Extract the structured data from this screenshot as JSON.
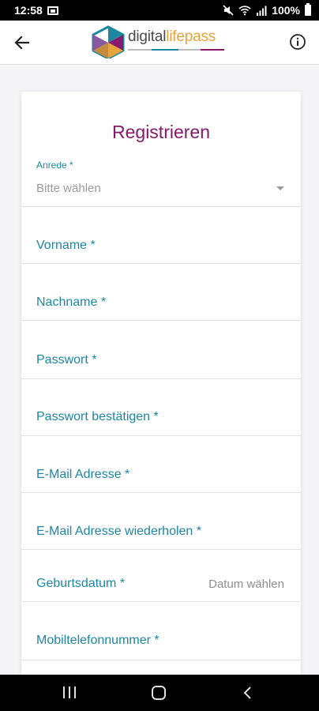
{
  "status_bar": {
    "time": "12:58",
    "battery": "100%"
  },
  "header": {
    "logo_text_a": "digital",
    "logo_text_b": "lifepass",
    "brand_colors": {
      "purple": "#86196b",
      "teal": "#1d86a1",
      "orange": "#e8a33d",
      "grey": "#4a4a4a"
    }
  },
  "form": {
    "title": "Registrieren",
    "salutation": {
      "label": "Anrede *",
      "placeholder": "Bitte wählen"
    },
    "fields": {
      "first_name": "Vorname *",
      "last_name": "Nachname *",
      "password": "Passwort *",
      "password_confirm": "Passwort bestätigen *",
      "email": "E-Mail Adresse *",
      "email_repeat": "E-Mail Adresse wiederholen *",
      "birthdate": "Geburtsdatum *",
      "birthdate_placeholder": "Datum wählen",
      "mobile": "Mobiltelefonnummer *"
    }
  },
  "icons": {
    "back": "arrow-left-icon",
    "info": "info-circle-icon",
    "dropdown": "caret-down-icon"
  }
}
